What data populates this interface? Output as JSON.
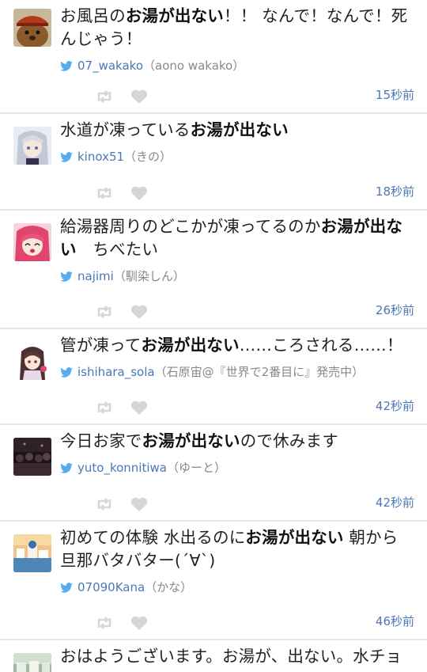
{
  "colors": {
    "link": "#4a78b5",
    "muted": "#888888",
    "bird": "#55acee",
    "icon": "#d6d6d6"
  },
  "tweets": [
    {
      "pre": "お風呂の",
      "hl": "お湯が出ない",
      "post": "！！ なんで！なんで！死んじゃう！",
      "username": "07_wakako",
      "display_name": "（aono wakako）",
      "time": "15秒前",
      "avatar": "hamster"
    },
    {
      "pre": "水道が凍っている",
      "hl": "お湯が出ない",
      "post": "",
      "username": "kinox51",
      "display_name": "（きの）",
      "time": "18秒前",
      "avatar": "silver-hair"
    },
    {
      "pre": "給湯器周りのどこかが凍ってるのか",
      "hl": "お湯が出ない",
      "post": "　ちべたい",
      "username": "najimi",
      "display_name": "（馴染しん）",
      "time": "26秒前",
      "avatar": "pink-hair"
    },
    {
      "pre": "管が凍って",
      "hl": "お湯が出ない",
      "post": "……ころされる……！",
      "username": "ishihara_sola",
      "display_name": "（石原宙@『世界で2番目に』発売中）",
      "time": "42秒前",
      "avatar": "anime-girl"
    },
    {
      "pre": "今日お家で",
      "hl": "お湯が出ない",
      "post": "ので休みます",
      "username": "yuto_konnitiwa",
      "display_name": "（ゆーと）",
      "time": "42秒前",
      "avatar": "crowd"
    },
    {
      "pre": "初めての体験 水出るのに",
      "hl": "お湯が出ない",
      "post": " 朝から旦那バタバター(´∀`)",
      "username": "07090Kana",
      "display_name": "（かな）",
      "time": "46秒前",
      "avatar": "santorini"
    },
    {
      "pre": "おはようございます。お湯が、出ない。水チョ",
      "hl": "",
      "post": "",
      "username": "",
      "display_name": "",
      "time": "",
      "avatar": "town"
    }
  ]
}
